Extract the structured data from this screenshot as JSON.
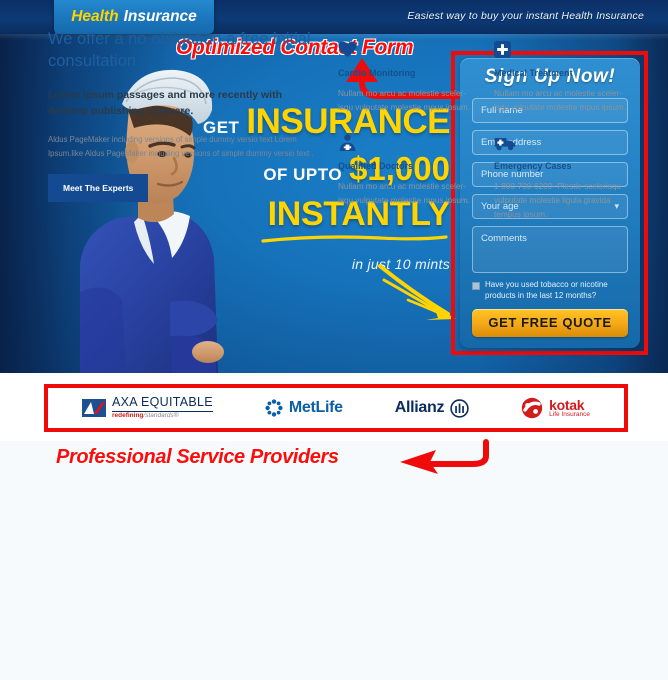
{
  "header": {
    "brand_primary": "Health",
    "brand_secondary": "Insurance",
    "tagline": "Easiest way to buy your instant Health Insurance"
  },
  "hero": {
    "get_label": "GET",
    "insurance_label": "INSURANCE",
    "upto_label": "OF UPTO",
    "amount": "$1,000",
    "instantly_label": "INSTANTLY",
    "subtext": "in just 10 mints"
  },
  "annotations": {
    "contact_form": "Optimized Contact Form",
    "providers": "Professional Service Providers",
    "accent_color": "#fc0d0d"
  },
  "form": {
    "title": "Sign Up Now!",
    "fields": [
      {
        "name": "full-name",
        "placeholder": "Full name",
        "value": "",
        "type": "text"
      },
      {
        "name": "email",
        "placeholder": "Email address",
        "value": "",
        "type": "text"
      },
      {
        "name": "phone",
        "placeholder": "Phone number",
        "value": "",
        "type": "text"
      },
      {
        "name": "age",
        "placeholder": "Your age",
        "value": "",
        "type": "select"
      },
      {
        "name": "comments",
        "placeholder": "Comments",
        "value": "",
        "type": "textarea"
      }
    ],
    "consent_label": "Have you used tobacco or nicotine products in the last 12 months?",
    "consent_checked": false,
    "submit_label": "GET FREE QUOTE",
    "submit_color": "#f5a918"
  },
  "logos": [
    {
      "name": "AXA EQUITABLE",
      "tagline_bold": "redefining",
      "tagline_slash": "/",
      "tagline_italic": "standards®"
    },
    {
      "name": "MetLife"
    },
    {
      "name": "Allianz"
    },
    {
      "name": "kotak",
      "sub": "Life Insurance"
    }
  ],
  "bottom": {
    "heading": "We offer a no obligation a free initial consultation",
    "lead": "Lorem Ipsum passages and more recently with desktop publishing software.",
    "small": "Aldus PageMaker including versions of simple dummy versio text Lorem Ipsum.like Aldus PageMaker including versions of simple dummy versio text .",
    "button_label": "Meet The Experts",
    "features": [
      {
        "icon": "heart-icon",
        "title": "Cardio Monitoring",
        "body": "Nullam mo arcu ac molestie sceler-isqu vulputate molestie mpus ipsum."
      },
      {
        "icon": "medical-cross-icon",
        "title": "Medical Treatment",
        "body": "Nullam mo arcu ac molestie sceler-isqu vulputate molestie mpus ipsum."
      },
      {
        "icon": "doctor-icon",
        "title": "Qualified Doctors",
        "body": "Nullam mo arcu ac molestie sceler-isqu vulputate molestie mpus ipsum."
      },
      {
        "icon": "ambulance-icon",
        "title": "Emergency Cases",
        "body": "1-800-700-6200- Plestie scelerisqu vulputate molestie ligula gravida tempus ipsum."
      }
    ]
  }
}
